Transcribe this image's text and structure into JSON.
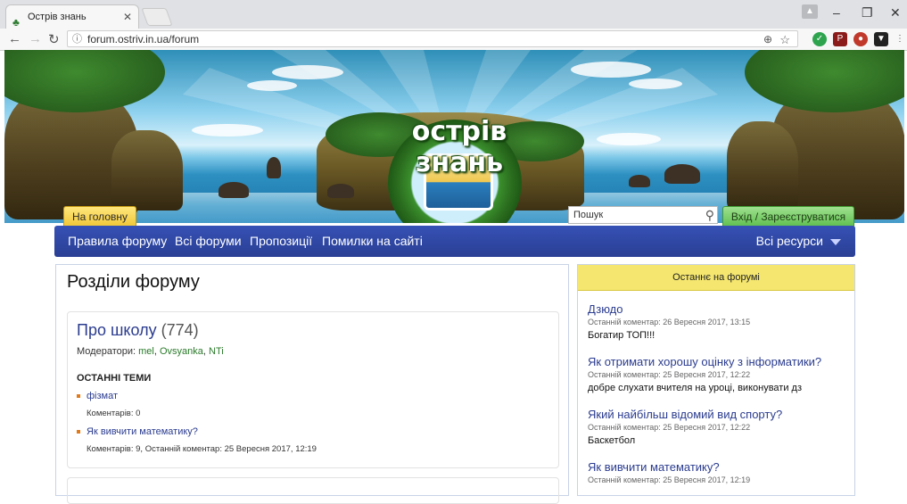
{
  "browser": {
    "tab_title": "Острів знань",
    "url": "forum.ostriv.in.ua/forum"
  },
  "banner": {
    "logo_text": "острів знань"
  },
  "header": {
    "home_tab": "На головну",
    "search_placeholder": "Пошук",
    "login_tab": "Вхід / Зареєструватися"
  },
  "nav": {
    "items": [
      "Правила форуму",
      "Всі форуми",
      "Пропозиції",
      "Помилки на сайті"
    ],
    "resources": "Всі ресурси"
  },
  "main": {
    "title": "Розділи форуму",
    "section": {
      "name": "Про школу",
      "count": "(774)",
      "moderators_label": "Модератори:",
      "moderators": [
        "mel",
        "Ovsyanka",
        "NTi"
      ],
      "latest_label": "ОСТАННІ ТЕМИ",
      "topics": [
        {
          "title": "фізмат",
          "meta": "Коментарів: 0"
        },
        {
          "title": "Як вивчити математику?",
          "meta": "Коментарів: 9,  Останній коментар: 25 Вересня 2017, 12:19"
        }
      ]
    }
  },
  "sidebar": {
    "title": "Останнє на форумі",
    "posts": [
      {
        "title": "Дзюдо",
        "meta": "Останній коментар: 26 Вересня 2017, 13:15",
        "comment": "Богатир ТОП!!!"
      },
      {
        "title": "Як отримати хорошу оцінку з інформатики?",
        "meta": "Останній коментар: 25 Вересня 2017, 12:22",
        "comment": "добре слухати вчителя на уроці, виконувати дз"
      },
      {
        "title": "Який найбільш відомий вид спорту?",
        "meta": "Останній коментар: 25 Вересня 2017, 12:22",
        "comment": "Баскетбол"
      },
      {
        "title": "Як вивчити математику?",
        "meta": "Останній коментар: 25 Вересня 2017, 12:19",
        "comment": ""
      }
    ]
  },
  "colors": {
    "nav_bar": "#2f48a6",
    "home_tab": "#f0c636",
    "login_tab": "#5fbf4f",
    "sidebar_header": "#f4e66f",
    "link": "#2b3c8f",
    "moderator_link": "#2a7a2a"
  }
}
